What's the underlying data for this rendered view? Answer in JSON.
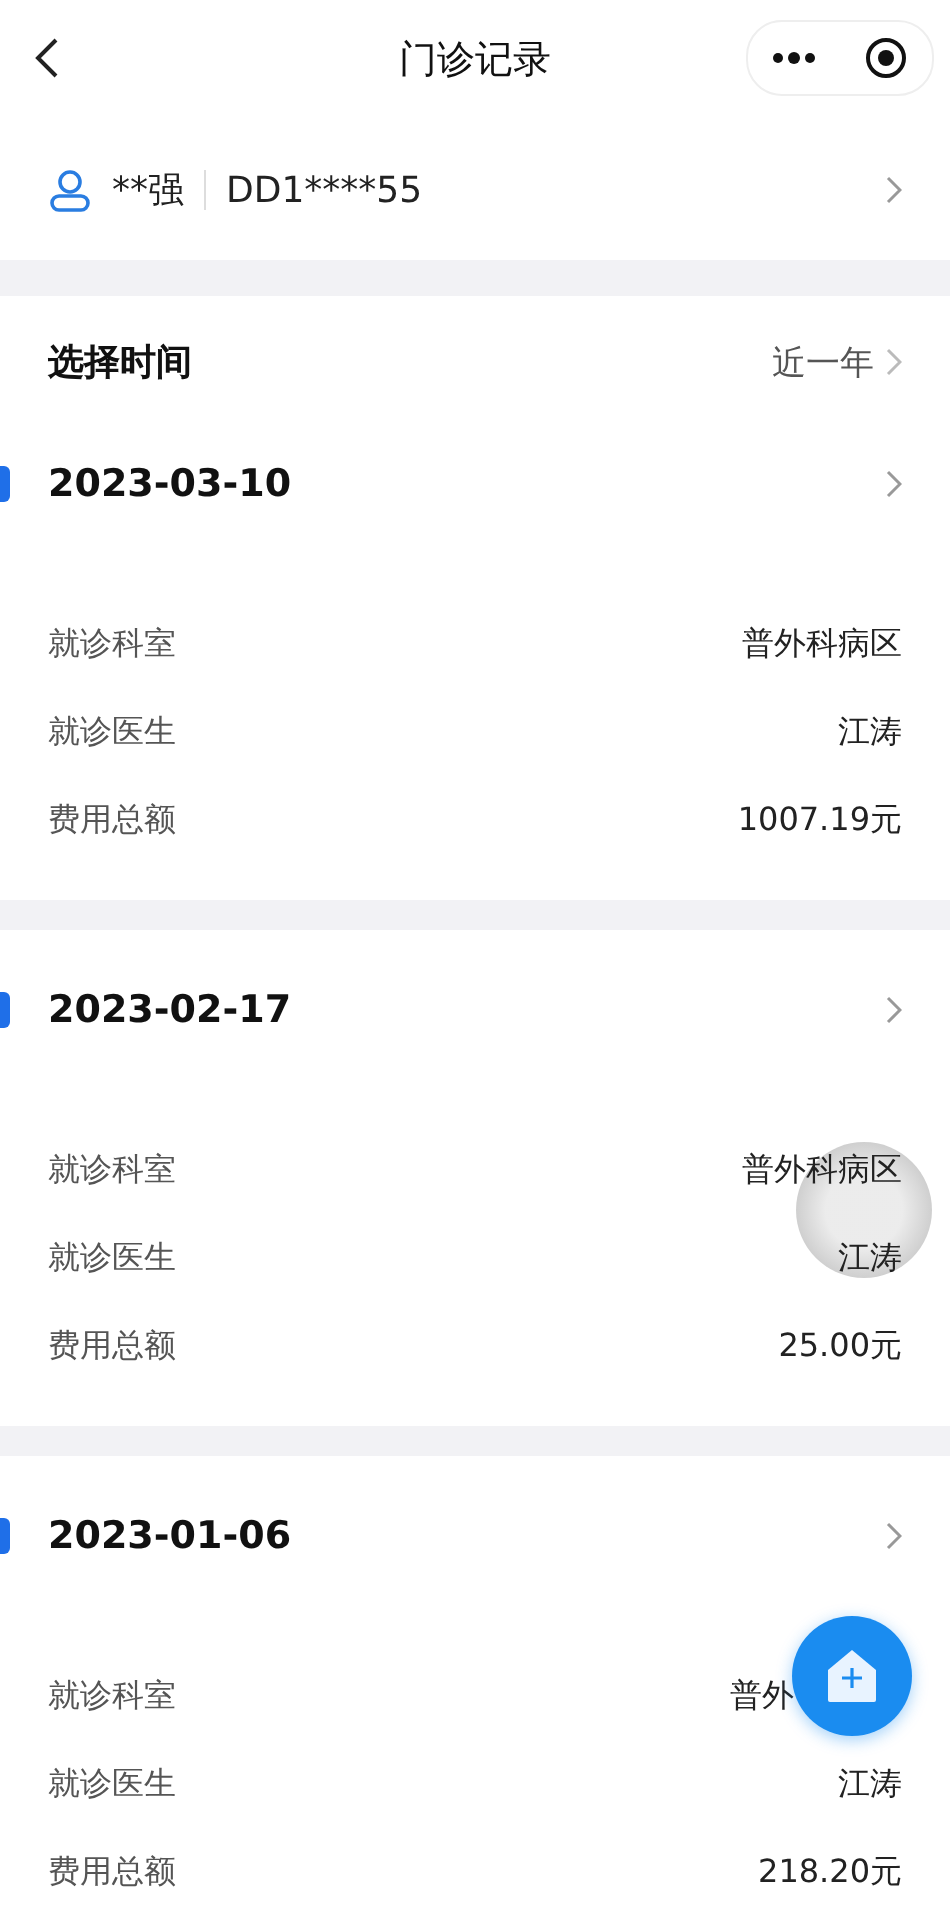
{
  "nav": {
    "title": "门诊记录"
  },
  "patient": {
    "name": "**强",
    "card_no": "DD1****55"
  },
  "filter": {
    "label": "选择时间",
    "value": "近一年"
  },
  "records": [
    {
      "date": "2023-03-10",
      "fields": [
        {
          "label": "就诊科室",
          "value": "普外科病区"
        },
        {
          "label": "就诊医生",
          "value": "江涛"
        },
        {
          "label": "费用总额",
          "value": "1007.19元"
        }
      ]
    },
    {
      "date": "2023-02-17",
      "fields": [
        {
          "label": "就诊科室",
          "value": "普外科病区"
        },
        {
          "label": "就诊医生",
          "value": "江涛"
        },
        {
          "label": "费用总额",
          "value": "25.00元"
        }
      ]
    },
    {
      "date": "2023-01-06",
      "fields": [
        {
          "label": "就诊科室",
          "value": "普外"
        },
        {
          "label": "就诊医生",
          "value": "江涛"
        },
        {
          "label": "费用总额",
          "value": "218.20元"
        }
      ]
    }
  ]
}
